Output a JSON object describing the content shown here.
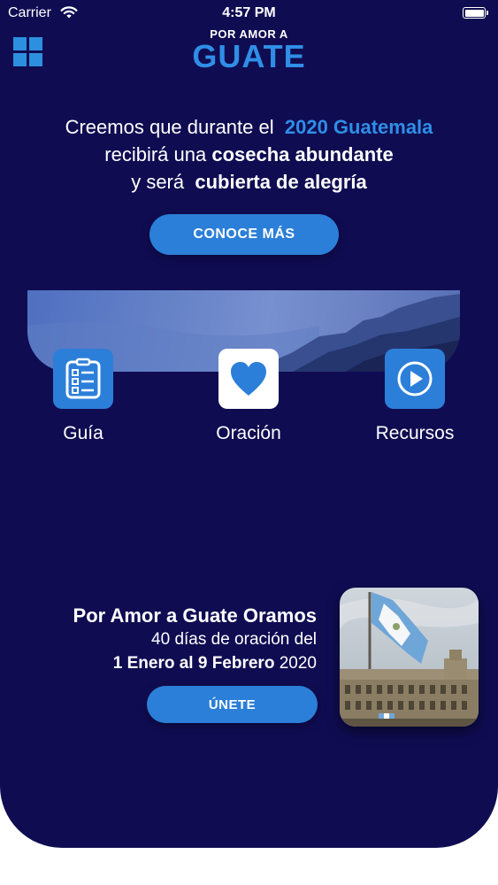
{
  "status_bar": {
    "carrier": "Carrier",
    "time": "4:57 PM"
  },
  "header": {
    "logo_small": "POR AMOR A",
    "logo_big": "GUATE"
  },
  "hero": {
    "line1_text": "Creemos que durante el",
    "line1_accent": "2020 Guatemala",
    "line2_text": "recibirá una",
    "line2_bold": "cosecha abundante",
    "line3_text": "y será",
    "line3_bold": "cubierta de alegría",
    "cta_label": "CONOCE MÁS"
  },
  "nav": [
    {
      "label": "Guía",
      "icon": "checklist-icon",
      "tile_color": "#2c7fd9"
    },
    {
      "label": "Oración",
      "icon": "heart-icon",
      "tile_color": "#ffffff"
    },
    {
      "label": "Recursos",
      "icon": "play-icon",
      "tile_color": "#2c7fd9"
    }
  ],
  "promo": {
    "title": "Por Amor a Guate Oramos",
    "subtitle": "40 días de oración del",
    "dates_bold": "1 Enero al 9 Febrero",
    "year": "2020",
    "join_label": "ÚNETE"
  },
  "colors": {
    "background": "#100c52",
    "accent": "#2f8ee6",
    "button": "#2b7fd8"
  }
}
